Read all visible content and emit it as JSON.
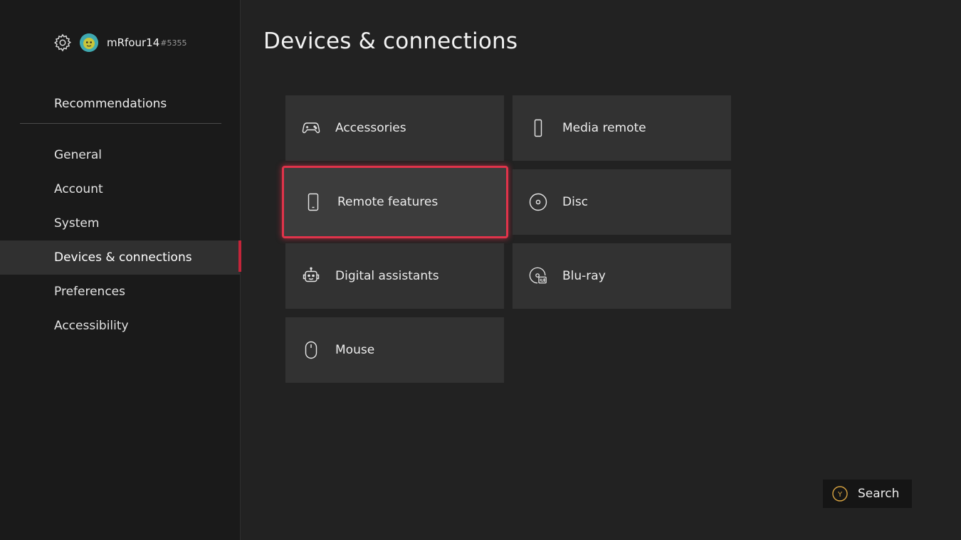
{
  "profile": {
    "gamertag": "mRfour14",
    "suffix": "#5355"
  },
  "sidebar": {
    "top_item": "Recommendations",
    "items": [
      {
        "label": "General"
      },
      {
        "label": "Account"
      },
      {
        "label": "System"
      },
      {
        "label": "Devices & connections",
        "selected": true
      },
      {
        "label": "Preferences"
      },
      {
        "label": "Accessibility"
      }
    ]
  },
  "page": {
    "title": "Devices & connections"
  },
  "tiles": [
    {
      "label": "Accessories",
      "icon": "controller-icon"
    },
    {
      "label": "Media remote",
      "icon": "remote-icon"
    },
    {
      "label": "Remote features",
      "icon": "phone-icon",
      "focused": true
    },
    {
      "label": "Disc",
      "icon": "disc-icon"
    },
    {
      "label": "Digital assistants",
      "icon": "assistant-icon"
    },
    {
      "label": "Blu-ray",
      "icon": "bluray-icon"
    },
    {
      "label": "Mouse",
      "icon": "mouse-icon"
    }
  ],
  "footer": {
    "search_button": "Y",
    "search_label": "Search"
  },
  "colors": {
    "accent": "#e0334a",
    "background": "#222222",
    "sidebar": "#1a1a1a",
    "tile": "#323232",
    "y_button": "#d9a441"
  }
}
